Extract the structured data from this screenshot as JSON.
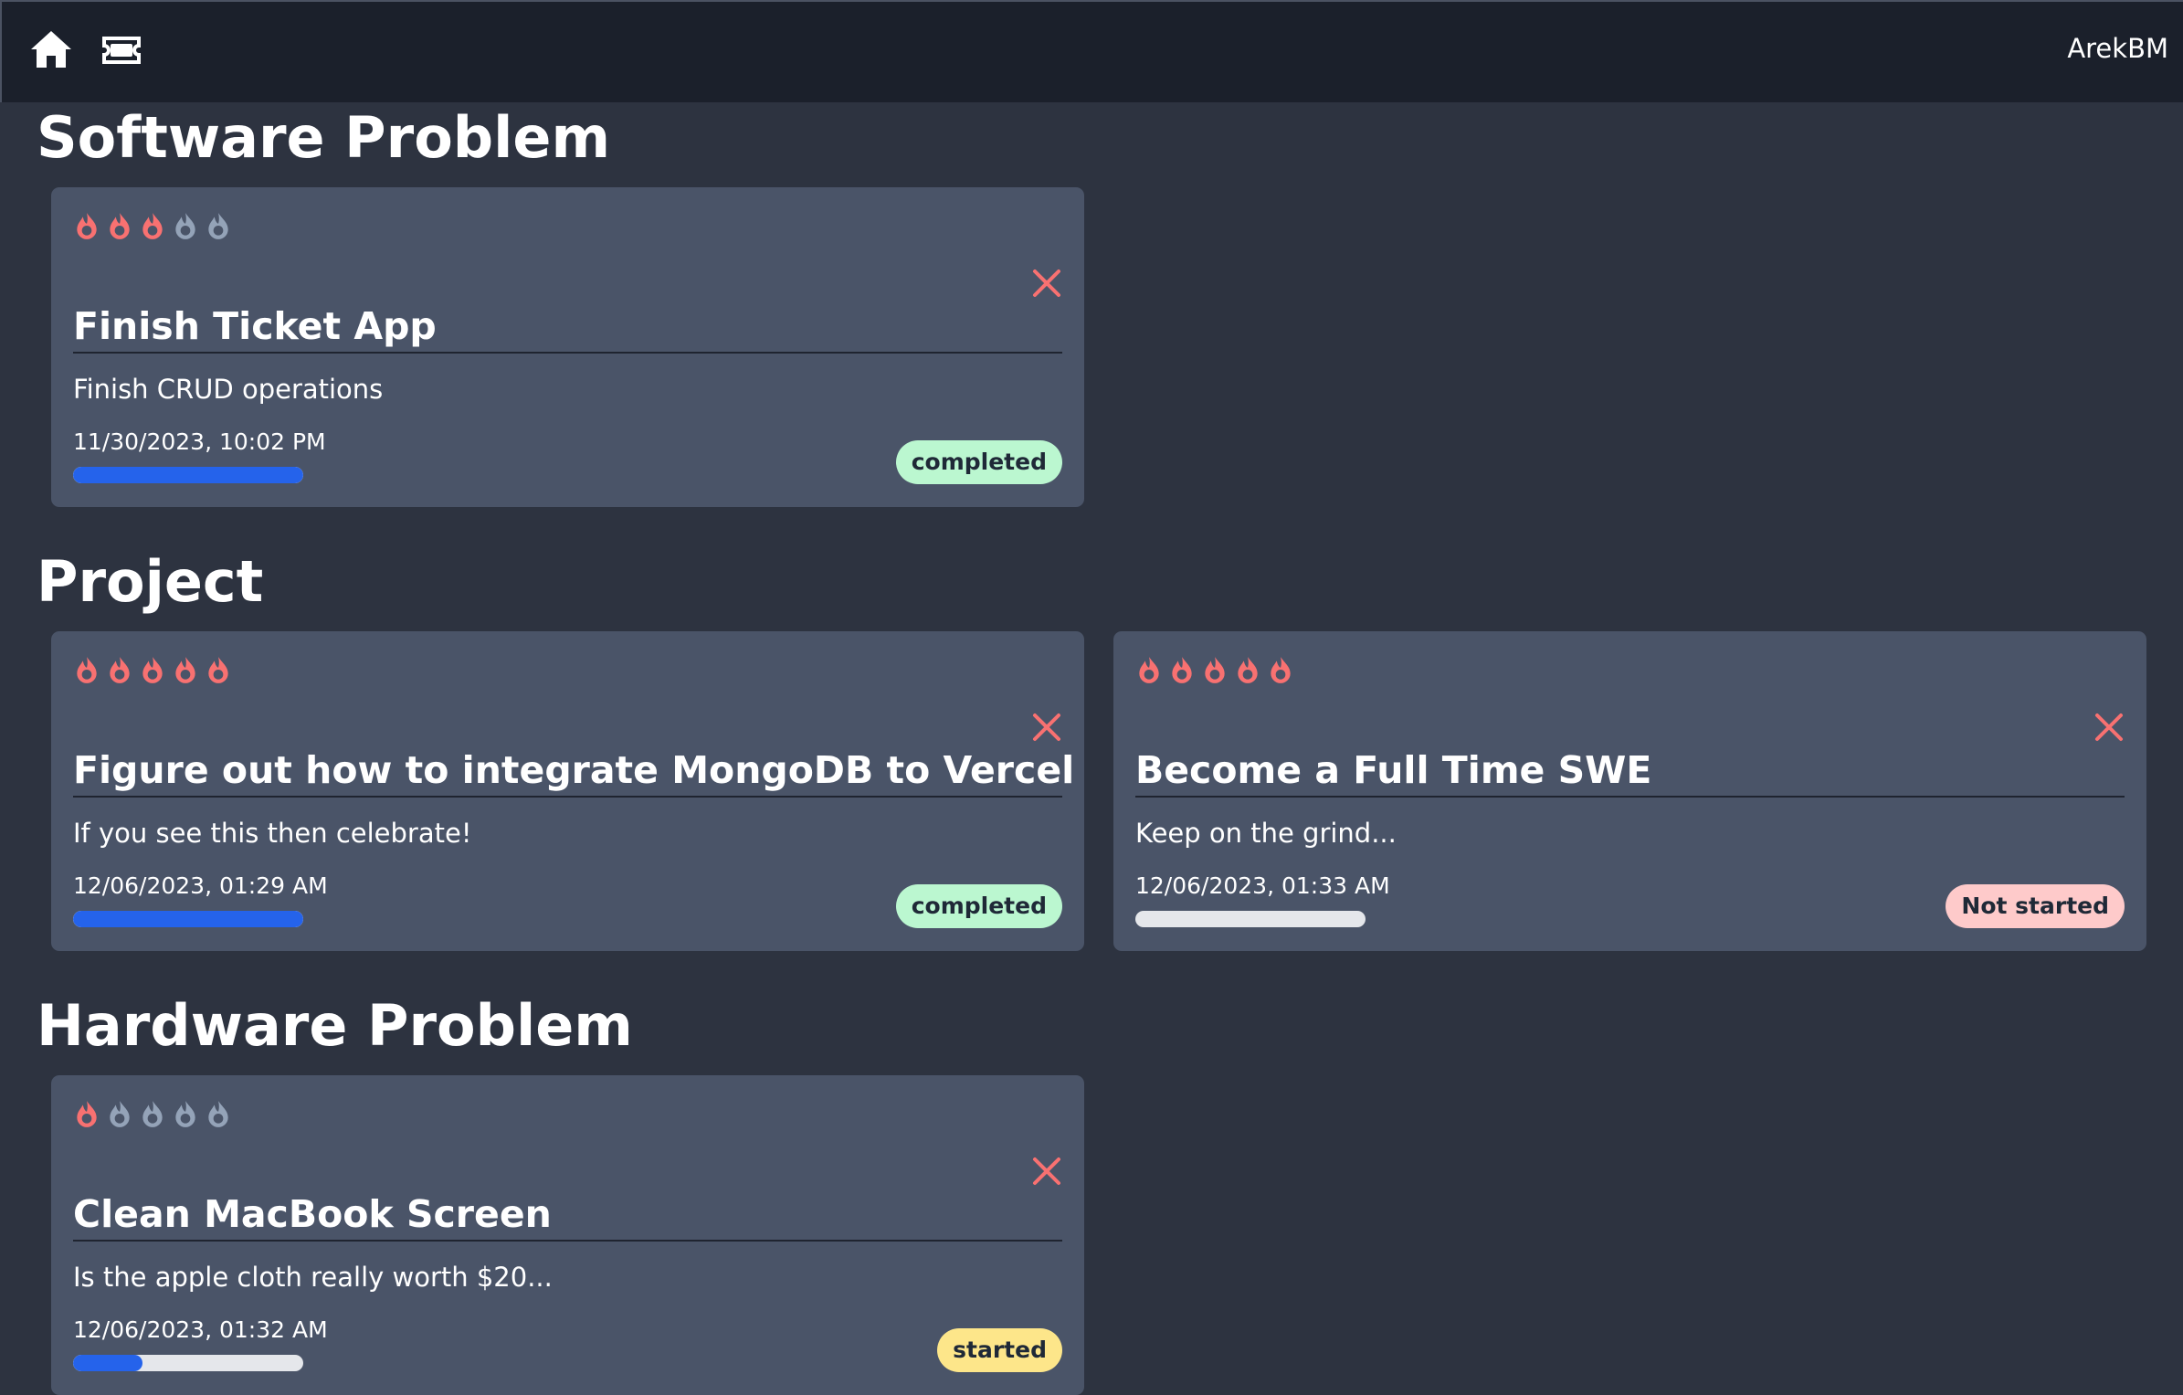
{
  "navbar": {
    "home_icon": "home-icon",
    "ticket_icon": "ticket-icon",
    "user": "ArekBM"
  },
  "colors": {
    "fire_active": "#f87171",
    "fire_inactive": "#94a3b8",
    "close": "#f87171",
    "progress_fill": "#2563eb",
    "progress_track": "#e5e7eb"
  },
  "sections": [
    {
      "title": "Software Problem",
      "tickets": [
        {
          "priority": 3,
          "title": "Finish Ticket App",
          "description": "Finish CRUD operations",
          "date": "11/30/2023, 10:02 PM",
          "progress": 100,
          "status": "completed"
        }
      ]
    },
    {
      "title": "Project",
      "tickets": [
        {
          "priority": 5,
          "title": "Figure out how to integrate MongoDB to Vercel",
          "description": "If you see this then celebrate!",
          "date": "12/06/2023, 01:29 AM",
          "progress": 100,
          "status": "completed"
        },
        {
          "priority": 5,
          "title": "Become a Full Time SWE",
          "description": "Keep on the grind...",
          "date": "12/06/2023, 01:33 AM",
          "progress": 0,
          "status": "Not started"
        }
      ]
    },
    {
      "title": "Hardware Problem",
      "tickets": [
        {
          "priority": 1,
          "title": "Clean MacBook Screen",
          "description": "Is the apple cloth really worth $20...",
          "date": "12/06/2023, 01:32 AM",
          "progress": 30,
          "status": "started"
        }
      ]
    }
  ]
}
